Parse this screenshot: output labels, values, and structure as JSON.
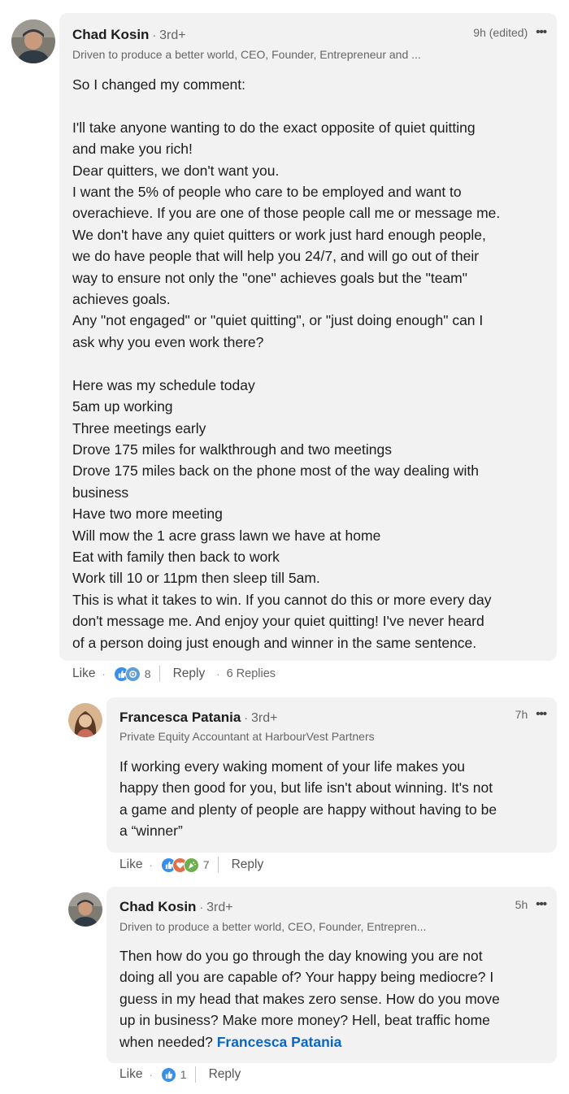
{
  "comment1": {
    "author": "Chad Kosin",
    "degree": "3rd+",
    "headline": "Driven to produce a better world, CEO, Founder, Entrepreneur and ...",
    "time": "9h (edited)",
    "lines": "So I changed my comment:\n\nI'll take anyone wanting to do the exact opposite of quiet quitting\nand make you rich!\nDear quitters, we don't want you.\nI want the 5% of people who care to be employed and want to\noverachieve. If you are one of those people call me or message me.\nWe don't have any quiet quitters or work just hard enough people,\nwe do have people that will help you 24/7, and will go out of their\nway to ensure not only the \"one\" achieves goals but the \"team\"\nachieves goals.\nAny \"not engaged\" or \"quiet quitting\", or \"just doing enough\" can I\nask why you even work there?\n\nHere was my schedule today\n5am up working\nThree meetings early\nDrove 175 miles for walkthrough and two meetings\nDrove 175 miles back on the phone most of the way dealing with\nbusiness\nHave two more meeting\nWill mow the 1 acre grass lawn we have at home\nEat with family then back to work\nWork till 10 or 11pm then sleep till 5am.\nThis is what it takes to win. If you cannot do this or more every day\ndon't message me. And enjoy your quiet quitting! I've never heard\nof a person doing just enough and winner in the same sentence.",
    "like_label": "Like",
    "reaction_count": "8",
    "reply_label": "Reply",
    "replies_label": "6 Replies",
    "reactions": [
      "like-icon",
      "support-icon"
    ]
  },
  "reply1": {
    "author": "Francesca Patania",
    "degree": "3rd+",
    "headline": "Private Equity Accountant at HarbourVest Partners",
    "time": "7h",
    "lines": "If working every waking moment of your life makes you\nhappy then good for you, but life isn't about winning. It's not\na game and plenty of people are happy without having to be\na “winner”",
    "like_label": "Like",
    "reaction_count": "7",
    "reply_label": "Reply",
    "reactions": [
      "like-icon",
      "love-icon",
      "celebrate-icon"
    ]
  },
  "reply2": {
    "author": "Chad Kosin",
    "degree": "3rd+",
    "headline": "Driven to produce a better world, CEO, Founder, Entrepren...",
    "time": "5h",
    "lines": "Then how do you go through the day knowing you are not\ndoing all you are capable of? Your happy being mediocre? I\nguess in my head that makes zero sense. How do you move\nup in business? Make more money? Hell, beat traffic home\nwhen needed? ",
    "mention": "Francesca Patania",
    "like_label": "Like",
    "reaction_count": "1",
    "reply_label": "Reply",
    "reactions": [
      "like-icon"
    ]
  },
  "colors": {
    "bubble": "#f2f2f2",
    "link": "#0a66c2",
    "like": "#378fe9",
    "love": "#df704d",
    "celebrate": "#6dae4f",
    "support": "#5f9ed6"
  },
  "separator": "·",
  "more_glyph": "•••"
}
